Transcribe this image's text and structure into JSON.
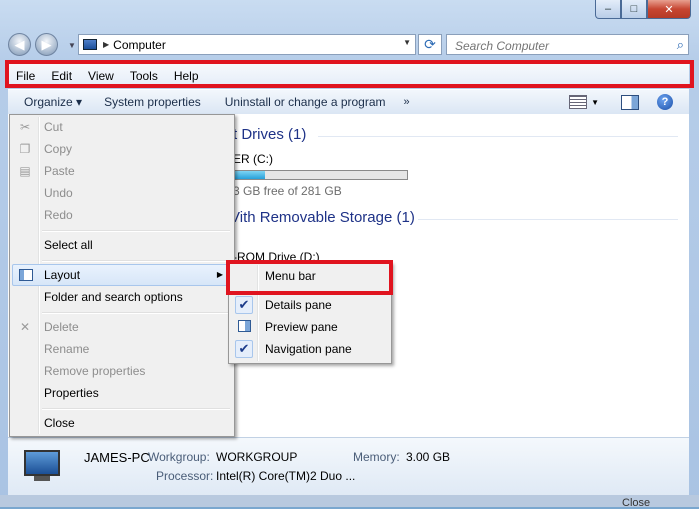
{
  "window": {
    "caption_buttons": {
      "minimize": "–",
      "maximize": "□",
      "close": "✕"
    }
  },
  "nav": {
    "back_glyph": "◀",
    "forward_glyph": "▶",
    "address": "Computer",
    "address_separator": "▶",
    "refresh_glyph": "⟳",
    "search_placeholder": "Search Computer"
  },
  "menubar": [
    "File",
    "Edit",
    "View",
    "Tools",
    "Help"
  ],
  "commandbar": {
    "organize": "Organize ▾",
    "system_properties": "System properties",
    "uninstall": "Uninstall or change a program",
    "more": "»",
    "help": "?"
  },
  "content": {
    "hard_drives_header": "t Drives (1)",
    "drive_name": "ER (C:)",
    "drive_free": "3 GB free of 281 GB",
    "drive_used_fraction": 0.18,
    "removable_header": "Vith Removable Storage (1)",
    "rom_drive": "-ROM Drive (D:)"
  },
  "organize_menu": {
    "items": [
      {
        "label": "Cut",
        "disabled": true,
        "icon": "cut-icon",
        "glyph": "✂"
      },
      {
        "label": "Copy",
        "disabled": true,
        "icon": "copy-icon",
        "glyph": "❐"
      },
      {
        "label": "Paste",
        "disabled": true,
        "icon": "paste-icon",
        "glyph": "📋"
      },
      {
        "label": "Undo",
        "disabled": true
      },
      {
        "label": "Redo",
        "disabled": true
      },
      {
        "label": "Select all",
        "disabled": false
      },
      {
        "label": "Layout",
        "disabled": false,
        "submenu": true,
        "arrow": "▶"
      },
      {
        "label": "Folder and search options",
        "disabled": false
      },
      {
        "label": "Delete",
        "disabled": true,
        "icon": "delete-icon",
        "glyph": "✕"
      },
      {
        "label": "Rename",
        "disabled": true
      },
      {
        "label": "Remove properties",
        "disabled": true
      },
      {
        "label": "Properties",
        "disabled": false
      },
      {
        "label": "Close",
        "disabled": false
      }
    ]
  },
  "layout_submenu": {
    "items": [
      {
        "label": "Menu bar",
        "checked": false
      },
      {
        "label": "Details pane",
        "checked": true,
        "check_glyph": "✔"
      },
      {
        "label": "Preview pane",
        "checked": false
      },
      {
        "label": "Navigation pane",
        "checked": true,
        "check_glyph": "✔"
      }
    ]
  },
  "details": {
    "computer_name": "JAMES-PC",
    "workgroup_label": "Workgroup:",
    "workgroup": "WORKGROUP",
    "memory_label": "Memory:",
    "memory": "3.00 GB",
    "processor_label": "Processor:",
    "processor": "Intel(R) Core(TM)2 Duo ..."
  },
  "behind_text": "Close",
  "colors": {
    "highlight_red": "#e0141f",
    "group_header_blue": "#1e3287"
  }
}
